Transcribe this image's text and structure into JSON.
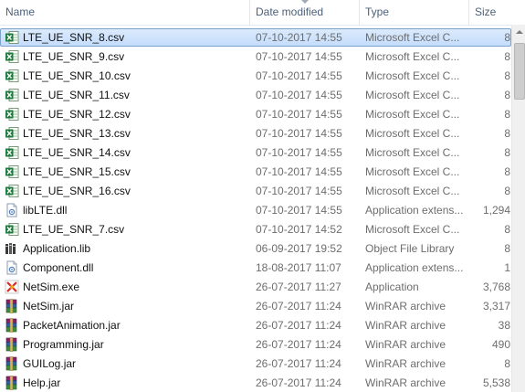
{
  "columns": {
    "name": "Name",
    "date": "Date modified",
    "type": "Type",
    "size": "Size"
  },
  "files": [
    {
      "name": "LTE_UE_SNR_8.csv",
      "date": "07-10-2017 14:55",
      "type": "Microsoft Excel C...",
      "size": "8",
      "icon": "excel-csv-icon"
    },
    {
      "name": "LTE_UE_SNR_9.csv",
      "date": "07-10-2017 14:55",
      "type": "Microsoft Excel C...",
      "size": "8",
      "icon": "excel-csv-icon"
    },
    {
      "name": "LTE_UE_SNR_10.csv",
      "date": "07-10-2017 14:55",
      "type": "Microsoft Excel C...",
      "size": "8",
      "icon": "excel-csv-icon"
    },
    {
      "name": "LTE_UE_SNR_11.csv",
      "date": "07-10-2017 14:55",
      "type": "Microsoft Excel C...",
      "size": "8",
      "icon": "excel-csv-icon"
    },
    {
      "name": "LTE_UE_SNR_12.csv",
      "date": "07-10-2017 14:55",
      "type": "Microsoft Excel C...",
      "size": "8",
      "icon": "excel-csv-icon"
    },
    {
      "name": "LTE_UE_SNR_13.csv",
      "date": "07-10-2017 14:55",
      "type": "Microsoft Excel C...",
      "size": "8",
      "icon": "excel-csv-icon"
    },
    {
      "name": "LTE_UE_SNR_14.csv",
      "date": "07-10-2017 14:55",
      "type": "Microsoft Excel C...",
      "size": "8",
      "icon": "excel-csv-icon"
    },
    {
      "name": "LTE_UE_SNR_15.csv",
      "date": "07-10-2017 14:55",
      "type": "Microsoft Excel C...",
      "size": "8",
      "icon": "excel-csv-icon"
    },
    {
      "name": "LTE_UE_SNR_16.csv",
      "date": "07-10-2017 14:55",
      "type": "Microsoft Excel C...",
      "size": "8",
      "icon": "excel-csv-icon"
    },
    {
      "name": "libLTE.dll",
      "date": "07-10-2017 14:55",
      "type": "Application extens...",
      "size": "1,294",
      "icon": "dll-icon"
    },
    {
      "name": "LTE_UE_SNR_7.csv",
      "date": "07-10-2017 14:52",
      "type": "Microsoft Excel C...",
      "size": "8",
      "icon": "excel-csv-icon"
    },
    {
      "name": "Application.lib",
      "date": "06-09-2017 19:52",
      "type": "Object File Library",
      "size": "8",
      "icon": "lib-icon"
    },
    {
      "name": "Component.dll",
      "date": "18-08-2017 11:07",
      "type": "Application extens...",
      "size": "1",
      "icon": "dll-icon"
    },
    {
      "name": "NetSim.exe",
      "date": "26-07-2017 11:27",
      "type": "Application",
      "size": "3,768",
      "icon": "netsim-exe-icon"
    },
    {
      "name": "NetSim.jar",
      "date": "26-07-2017 11:24",
      "type": "WinRAR archive",
      "size": "3,317",
      "icon": "winrar-icon"
    },
    {
      "name": "PacketAnimation.jar",
      "date": "26-07-2017 11:24",
      "type": "WinRAR archive",
      "size": "38",
      "icon": "winrar-icon"
    },
    {
      "name": "Programming.jar",
      "date": "26-07-2017 11:24",
      "type": "WinRAR archive",
      "size": "490",
      "icon": "winrar-icon"
    },
    {
      "name": "GUILog.jar",
      "date": "26-07-2017 11:24",
      "type": "WinRAR archive",
      "size": "8",
      "icon": "winrar-icon"
    },
    {
      "name": "Help.jar",
      "date": "26-07-2017 11:24",
      "type": "WinRAR archive",
      "size": "5,538",
      "icon": "winrar-icon"
    }
  ],
  "selected_index": 0
}
